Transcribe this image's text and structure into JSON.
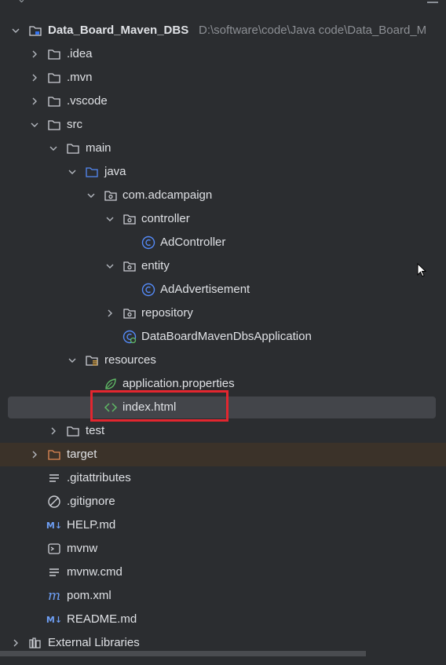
{
  "tree": {
    "project": {
      "name": "Data_Board_Maven_DBS",
      "path": "D:\\software\\code\\Java code\\Data_Board_M"
    },
    "folders": {
      "idea": ".idea",
      "mvn": ".mvn",
      "vscode": ".vscode",
      "src": "src",
      "main": "main",
      "java": "java",
      "package": "com.adcampaign",
      "controller": "controller",
      "ad_controller": "AdController",
      "entity": "entity",
      "ad_advertisement": "AdAdvertisement",
      "repository": "repository",
      "application": "DataBoardMavenDbsApplication",
      "resources": "resources",
      "app_properties": "application.properties",
      "index_html": "index.html",
      "test": "test",
      "target": "target"
    },
    "files": {
      "gitattributes": ".gitattributes",
      "gitignore": ".gitignore",
      "help_md": "HELP.md",
      "mvnw": "mvnw",
      "mvnw_cmd": "mvnw.cmd",
      "pom_xml": "pom.xml",
      "readme_md": "README.md"
    },
    "external_libraries": "External Libraries",
    "selected_item": "index.html",
    "highlight_color": "#e3262f",
    "selection_color": "#43454a",
    "excluded_color": "#3b3229"
  }
}
